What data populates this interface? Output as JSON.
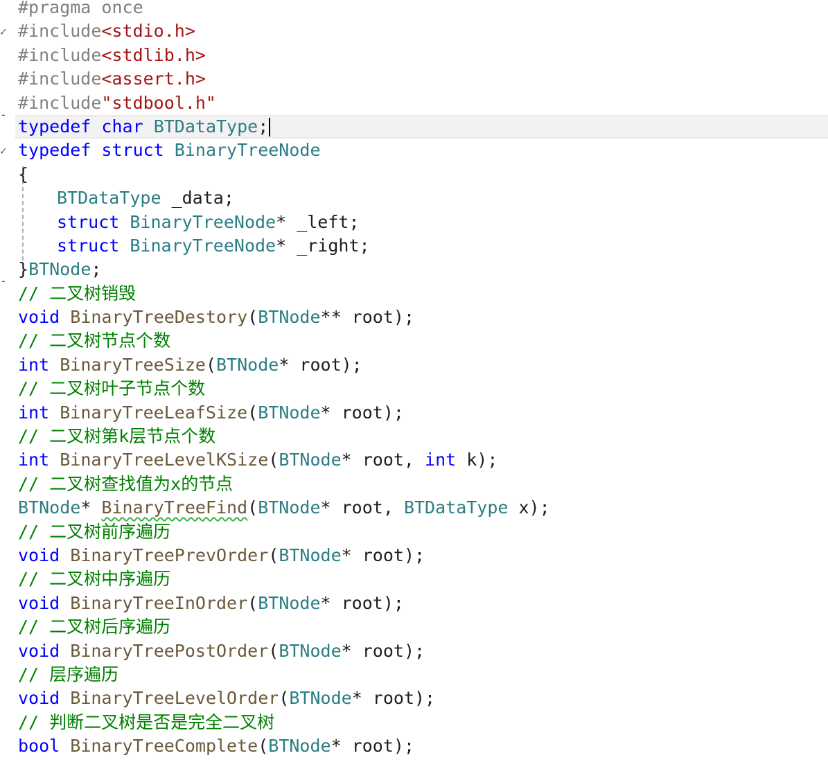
{
  "editor": {
    "colors": {
      "keyword": "#0000ff",
      "type": "#2b7d85",
      "function": "#6b5a3a",
      "preprocessor": "#808080",
      "string": "#a31515",
      "comment": "#008000",
      "current_line": "#f2f2f2",
      "squiggle": "#3cb043"
    },
    "lines": [
      {
        "tokens": [
          {
            "c": "pp",
            "t": "#pragma once"
          }
        ]
      },
      {
        "tokens": [
          {
            "c": "pp",
            "t": "#include"
          },
          {
            "c": "str",
            "t": "<stdio.h>"
          }
        ]
      },
      {
        "tokens": [
          {
            "c": "pp",
            "t": "#include"
          },
          {
            "c": "str",
            "t": "<stdlib.h>"
          }
        ]
      },
      {
        "tokens": [
          {
            "c": "pp",
            "t": "#include"
          },
          {
            "c": "str",
            "t": "<assert.h>"
          }
        ]
      },
      {
        "tokens": [
          {
            "c": "pp",
            "t": "#include"
          },
          {
            "c": "str",
            "t": "\"stdbool.h\""
          }
        ]
      },
      {
        "tokens": [
          {
            "c": "kw",
            "t": "typedef"
          },
          {
            "c": "pl",
            "t": " "
          },
          {
            "c": "kw",
            "t": "char"
          },
          {
            "c": "pl",
            "t": " "
          },
          {
            "c": "type",
            "t": "BTDataType"
          },
          {
            "c": "pl",
            "t": ";"
          }
        ]
      },
      {
        "tokens": [
          {
            "c": "kw",
            "t": "typedef"
          },
          {
            "c": "pl",
            "t": " "
          },
          {
            "c": "kw",
            "t": "struct"
          },
          {
            "c": "pl",
            "t": " "
          },
          {
            "c": "type",
            "t": "BinaryTreeNode"
          }
        ]
      },
      {
        "tokens": [
          {
            "c": "pl",
            "t": "{"
          }
        ]
      },
      {
        "tokens": [
          {
            "c": "type",
            "t": "BTDataType"
          },
          {
            "c": "pl",
            "t": " _data;"
          }
        ]
      },
      {
        "tokens": [
          {
            "c": "kw",
            "t": "struct"
          },
          {
            "c": "pl",
            "t": " "
          },
          {
            "c": "type",
            "t": "BinaryTreeNode"
          },
          {
            "c": "pl",
            "t": "* _left;"
          }
        ]
      },
      {
        "tokens": [
          {
            "c": "kw",
            "t": "struct"
          },
          {
            "c": "pl",
            "t": " "
          },
          {
            "c": "type",
            "t": "BinaryTreeNode"
          },
          {
            "c": "pl",
            "t": "* _right;"
          }
        ]
      },
      {
        "tokens": [
          {
            "c": "pl",
            "t": "}"
          },
          {
            "c": "type",
            "t": "BTNode"
          },
          {
            "c": "pl",
            "t": ";"
          }
        ]
      },
      {
        "tokens": [
          {
            "c": "cm",
            "t": "// 二叉树销毁"
          }
        ]
      },
      {
        "tokens": [
          {
            "c": "kw",
            "t": "void"
          },
          {
            "c": "pl",
            "t": " "
          },
          {
            "c": "fn",
            "t": "BinaryTreeDestory"
          },
          {
            "c": "pl",
            "t": "("
          },
          {
            "c": "type",
            "t": "BTNode"
          },
          {
            "c": "pl",
            "t": "** root);"
          }
        ]
      },
      {
        "tokens": [
          {
            "c": "cm",
            "t": "// 二叉树节点个数"
          }
        ]
      },
      {
        "tokens": [
          {
            "c": "kw",
            "t": "int"
          },
          {
            "c": "pl",
            "t": " "
          },
          {
            "c": "fn",
            "t": "BinaryTreeSize"
          },
          {
            "c": "pl",
            "t": "("
          },
          {
            "c": "type",
            "t": "BTNode"
          },
          {
            "c": "pl",
            "t": "* root);"
          }
        ]
      },
      {
        "tokens": [
          {
            "c": "cm",
            "t": "// 二叉树叶子节点个数"
          }
        ]
      },
      {
        "tokens": [
          {
            "c": "kw",
            "t": "int"
          },
          {
            "c": "pl",
            "t": " "
          },
          {
            "c": "fn",
            "t": "BinaryTreeLeafSize"
          },
          {
            "c": "pl",
            "t": "("
          },
          {
            "c": "type",
            "t": "BTNode"
          },
          {
            "c": "pl",
            "t": "* root);"
          }
        ]
      },
      {
        "tokens": [
          {
            "c": "cm",
            "t": "// 二叉树第k层节点个数"
          }
        ]
      },
      {
        "tokens": [
          {
            "c": "kw",
            "t": "int"
          },
          {
            "c": "pl",
            "t": " "
          },
          {
            "c": "fn",
            "t": "BinaryTreeLevelKSize"
          },
          {
            "c": "pl",
            "t": "("
          },
          {
            "c": "type",
            "t": "BTNode"
          },
          {
            "c": "pl",
            "t": "* root, "
          },
          {
            "c": "kw",
            "t": "int"
          },
          {
            "c": "pl",
            "t": " k);"
          }
        ]
      },
      {
        "tokens": [
          {
            "c": "cm",
            "t": "// 二叉树查找值为x的节点"
          }
        ]
      },
      {
        "tokens": [
          {
            "c": "type",
            "t": "BTNode"
          },
          {
            "c": "pl",
            "t": "* "
          },
          {
            "c": "fn squiggle",
            "t": "BinaryTreeFind"
          },
          {
            "c": "pl",
            "t": "("
          },
          {
            "c": "type",
            "t": "BTNode"
          },
          {
            "c": "pl",
            "t": "* root, "
          },
          {
            "c": "type",
            "t": "BTDataType"
          },
          {
            "c": "pl",
            "t": " x);"
          }
        ]
      },
      {
        "tokens": [
          {
            "c": "cm",
            "t": "// 二叉树前序遍历"
          }
        ]
      },
      {
        "tokens": [
          {
            "c": "kw",
            "t": "void"
          },
          {
            "c": "pl",
            "t": " "
          },
          {
            "c": "fn",
            "t": "BinaryTreePrevOrder"
          },
          {
            "c": "pl",
            "t": "("
          },
          {
            "c": "type",
            "t": "BTNode"
          },
          {
            "c": "pl",
            "t": "* root);"
          }
        ]
      },
      {
        "tokens": [
          {
            "c": "cm",
            "t": "// 二叉树中序遍历"
          }
        ]
      },
      {
        "tokens": [
          {
            "c": "kw",
            "t": "void"
          },
          {
            "c": "pl",
            "t": " "
          },
          {
            "c": "fn",
            "t": "BinaryTreeInOrder"
          },
          {
            "c": "pl",
            "t": "("
          },
          {
            "c": "type",
            "t": "BTNode"
          },
          {
            "c": "pl",
            "t": "* root);"
          }
        ]
      },
      {
        "tokens": [
          {
            "c": "cm",
            "t": "// 二叉树后序遍历"
          }
        ]
      },
      {
        "tokens": [
          {
            "c": "kw",
            "t": "void"
          },
          {
            "c": "pl",
            "t": " "
          },
          {
            "c": "fn",
            "t": "BinaryTreePostOrder"
          },
          {
            "c": "pl",
            "t": "("
          },
          {
            "c": "type",
            "t": "BTNode"
          },
          {
            "c": "pl",
            "t": "* root);"
          }
        ]
      },
      {
        "tokens": [
          {
            "c": "cm",
            "t": "// 层序遍历"
          }
        ]
      },
      {
        "tokens": [
          {
            "c": "kw",
            "t": "void"
          },
          {
            "c": "pl",
            "t": " "
          },
          {
            "c": "fn",
            "t": "BinaryTreeLevelOrder"
          },
          {
            "c": "pl",
            "t": "("
          },
          {
            "c": "type",
            "t": "BTNode"
          },
          {
            "c": "pl",
            "t": "* root);"
          }
        ]
      },
      {
        "tokens": [
          {
            "c": "cm",
            "t": "// 判断二叉树是否是完全二叉树"
          }
        ]
      },
      {
        "tokens": [
          {
            "c": "kw",
            "t": "bool"
          },
          {
            "c": "pl",
            "t": " "
          },
          {
            "c": "fn",
            "t": "BinaryTreeComplete"
          },
          {
            "c": "pl",
            "t": "("
          },
          {
            "c": "type",
            "t": "BTNode"
          },
          {
            "c": "pl",
            "t": "* root);"
          }
        ]
      }
    ]
  }
}
